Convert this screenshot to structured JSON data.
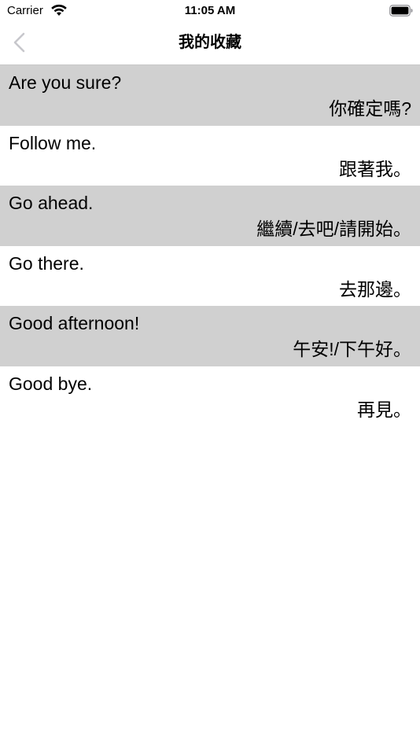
{
  "status_bar": {
    "carrier": "Carrier",
    "time": "11:05 AM",
    "wifi_icon": "wifi-icon",
    "battery_icon": "battery-icon"
  },
  "nav": {
    "title": "我的收藏",
    "back_icon": "chevron-left-icon",
    "accent_color": "#c7c7cc"
  },
  "colors": {
    "row_shaded": "#d0d0d0",
    "row_plain": "#ffffff"
  },
  "favorites": [
    {
      "en": "Are you sure?",
      "zh": "你確定嗎?"
    },
    {
      "en": "Follow me.",
      "zh": "跟著我。"
    },
    {
      "en": "Go ahead.",
      "zh": "繼續/去吧/請開始。"
    },
    {
      "en": "Go there.",
      "zh": "去那邊。"
    },
    {
      "en": "Good afternoon!",
      "zh": "午安!/下午好。"
    },
    {
      "en": "Good bye.",
      "zh": "再見。"
    }
  ]
}
